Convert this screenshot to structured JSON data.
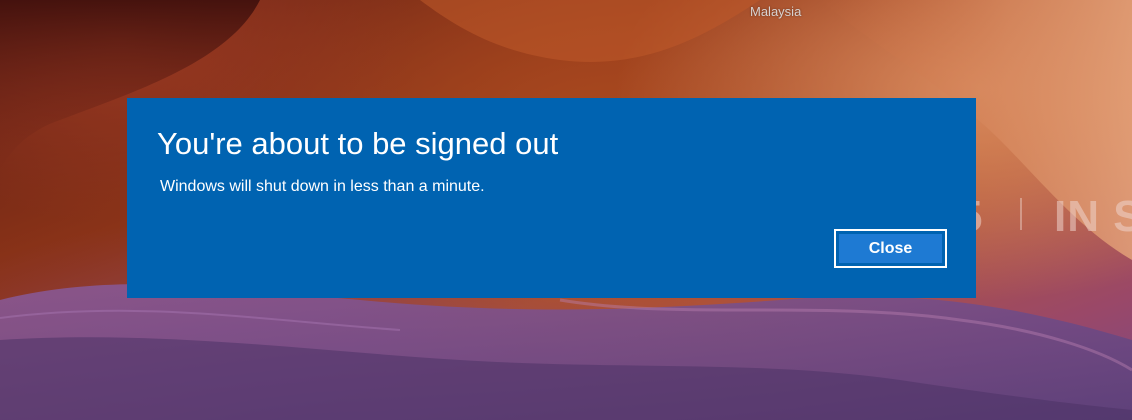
{
  "background": {
    "location": "Malaysia",
    "overlay_text_left": "5",
    "overlay_text_right": "IN SE"
  },
  "dialog": {
    "title": "You're about to be signed out",
    "message": "Windows will shut down in less than a minute.",
    "close_label": "Close",
    "accent_color": "#0063b1"
  }
}
